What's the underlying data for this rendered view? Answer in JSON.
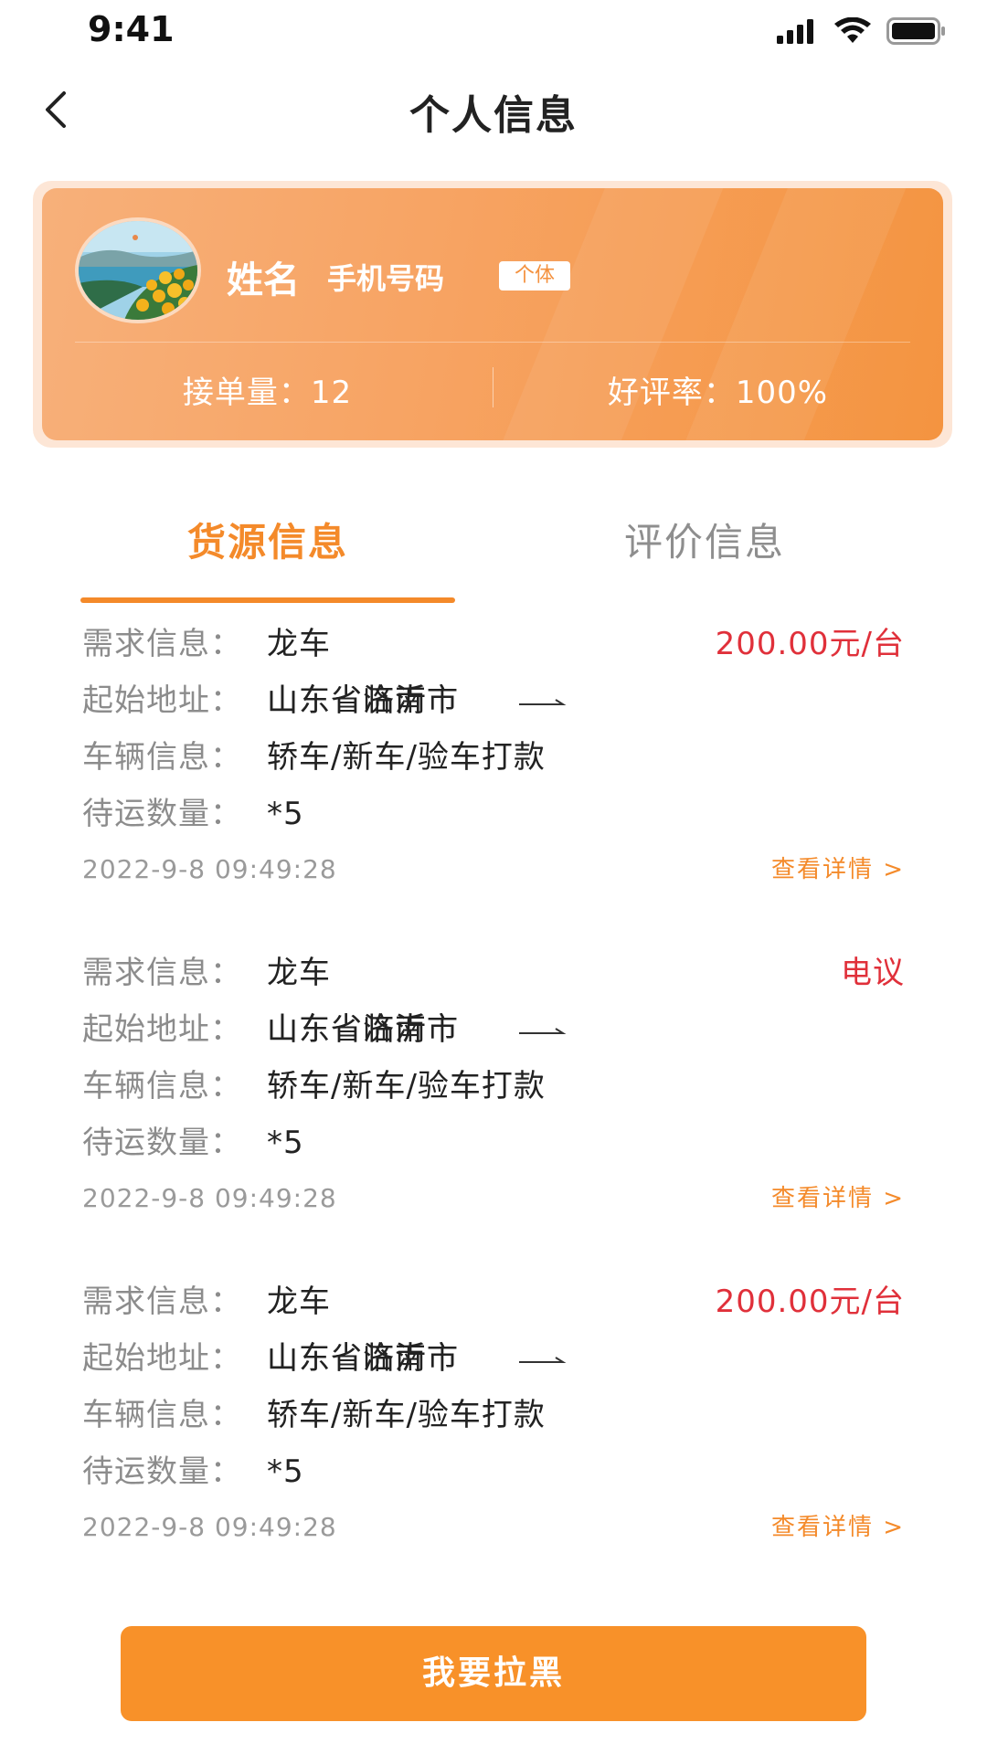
{
  "status_bar": {
    "time": "9:41",
    "icons": [
      "signal-icon",
      "wifi-icon",
      "battery-icon"
    ]
  },
  "nav": {
    "title": "个人信息",
    "back_icon": "chevron-left-icon"
  },
  "profile": {
    "name": "姓名",
    "phone": "手机号码",
    "badge": "个体",
    "orders_label": "接单量：12",
    "rating_label": "好评率：100%",
    "card_colors": [
      "#f7b07a",
      "#f49440"
    ]
  },
  "tabs": [
    {
      "label": "货源信息",
      "active": true
    },
    {
      "label": "评价信息",
      "active": false
    }
  ],
  "labels": {
    "demand": "需求信息：",
    "address": "起始地址：",
    "vehicle": "车辆信息：",
    "quantity": "待运数量：",
    "detail_link": "查看详情 >"
  },
  "items": [
    {
      "demand": "龙车",
      "price": "200.00元/台",
      "from": "山东省济南市",
      "to": "山东省临沂市",
      "vehicle": "轿车/新车/验车打款",
      "quantity": "*5",
      "date": "2022-9-8 09:49:28"
    },
    {
      "demand": "龙车",
      "price": "电议",
      "from": "山东省济南市",
      "to": "山东省临沂市",
      "vehicle": "轿车/新车/验车打款",
      "quantity": "*5",
      "date": "2022-9-8 09:49:28"
    },
    {
      "demand": "龙车",
      "price": "200.00元/台",
      "from": "山东省济南市",
      "to": "山东省临沂市",
      "vehicle": "轿车/新车/验车打款",
      "quantity": "*5",
      "date": "2022-9-8 09:49:28"
    }
  ],
  "actions": {
    "blacklist_button": "我要拉黑"
  },
  "colors": {
    "accent": "#f48a2a",
    "price": "#e0303a",
    "button": "#f89129"
  }
}
